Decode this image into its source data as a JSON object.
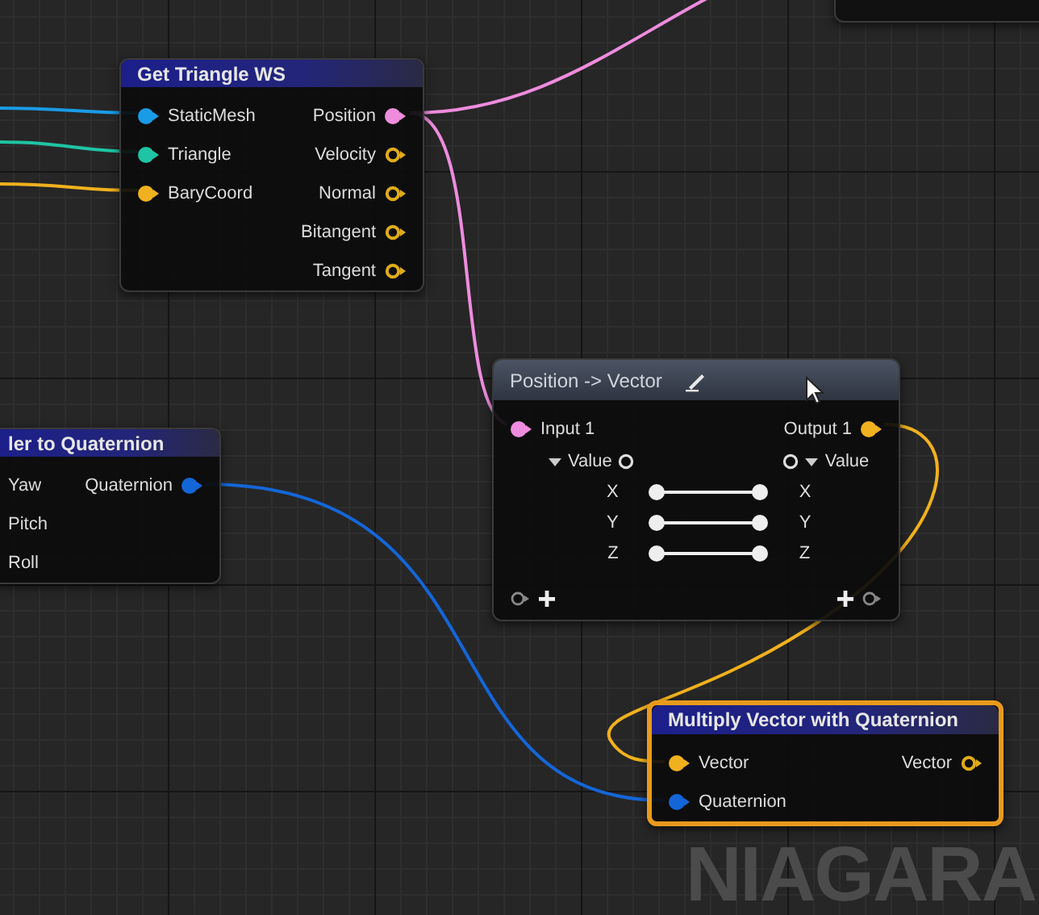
{
  "nodes": [
    {
      "kind": "stub",
      "selected": false
    },
    {
      "kind": "function",
      "title": "Get Triangle WS",
      "selected": false,
      "inputs": [
        {
          "label": "StaticMesh",
          "color": "#1a9be6",
          "connected": true
        },
        {
          "label": "Triangle",
          "color": "#1fc4a4",
          "connected": true
        },
        {
          "label": "BaryCoord",
          "color": "#f0b11e",
          "connected": true
        }
      ],
      "outputs": [
        {
          "label": "Position",
          "color": "#ee8cde",
          "connected": true
        },
        {
          "label": "Velocity",
          "color": "#e0ac18",
          "connected": false
        },
        {
          "label": "Normal",
          "color": "#e0ac18",
          "connected": false
        },
        {
          "label": "Bitangent",
          "color": "#e0ac18",
          "connected": false
        },
        {
          "label": "Tangent",
          "color": "#e0ac18",
          "connected": false
        }
      ]
    },
    {
      "kind": "function",
      "title": "ler to Quaternion",
      "selected": false,
      "inputs": [
        {
          "label": "Yaw"
        },
        {
          "label": "Pitch"
        },
        {
          "label": "Roll"
        }
      ],
      "outputs": [
        {
          "label": "Quaternion",
          "color": "#1466d8",
          "connected": true
        }
      ]
    },
    {
      "kind": "convert",
      "title": "Position -> Vector",
      "selected": false,
      "inputs": [
        {
          "label": "Input 1",
          "color": "#ee8cde",
          "connected": true
        }
      ],
      "outputs": [
        {
          "label": "Output 1",
          "color": "#f0b11e",
          "connected": true
        }
      ],
      "mapping": {
        "input_label": "Value",
        "output_label": "Value",
        "expanded": true,
        "fields": [
          {
            "in": "X",
            "out": "X"
          },
          {
            "in": "Y",
            "out": "Y"
          },
          {
            "in": "Z",
            "out": "Z"
          }
        ]
      }
    },
    {
      "kind": "function",
      "title": "Multiply Vector with Quaternion",
      "selected": true,
      "inputs": [
        {
          "label": "Vector",
          "color": "#f0b11e",
          "connected": true
        },
        {
          "label": "Quaternion",
          "color": "#1466d8",
          "connected": true
        }
      ],
      "outputs": [
        {
          "label": "Vector",
          "color": "#e0ac18",
          "connected": false
        }
      ]
    }
  ],
  "graph_label": "NIAGARA"
}
